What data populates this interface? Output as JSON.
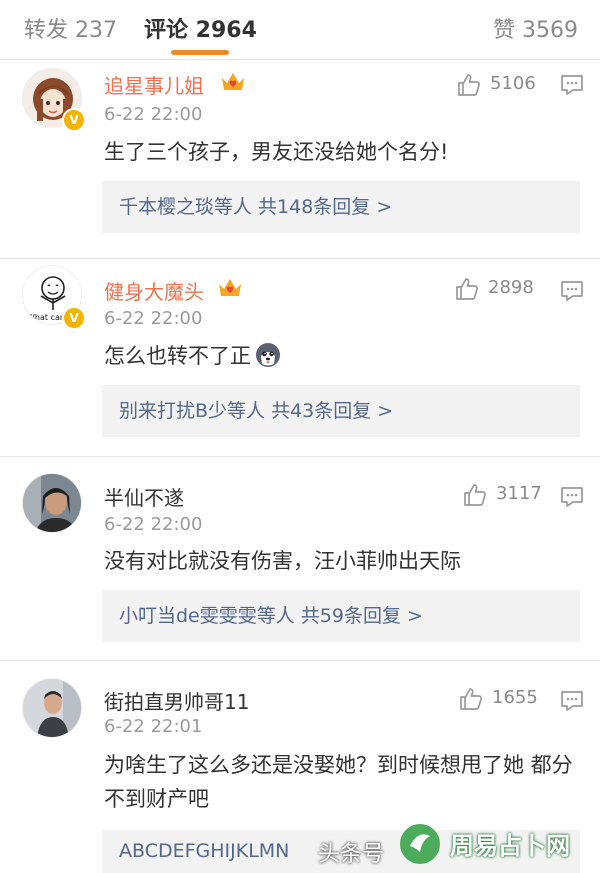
{
  "tabs": {
    "repost": "转发 237",
    "comments": "评论 2964",
    "likes": "赞 3569"
  },
  "colors": {
    "vip_name": "#eb7350",
    "tab_indicator": "#f08a24",
    "reply_link": "#55688a",
    "verified_badge": "#f5b400"
  },
  "icons": {
    "like": "thumbs-up-outline",
    "reply": "speech-bubble",
    "verified": "v-badge",
    "vip": "crown-heart"
  },
  "comments": [
    {
      "username": "追星事儿姐",
      "vip": true,
      "verified": true,
      "time": "6-22 22:00",
      "likes": "5106",
      "text": "生了三个孩子，男友还没给她个名分!",
      "replies": "千本樱之琰等人 共148条回复 >"
    },
    {
      "username": "健身大魔头",
      "vip": true,
      "verified": true,
      "avatar_text": "What can",
      "time": "6-22 22:00",
      "likes": "2898",
      "text": "怎么也转不了正",
      "replies": "别来打扰B少等人 共43条回复 >"
    },
    {
      "username": "半仙不遂",
      "vip": false,
      "verified": false,
      "time": "6-22 22:00",
      "likes": "3117",
      "text": "没有对比就没有伤害，汪小菲帅出天际",
      "replies": "小叮当de雯雯雯等人 共59条回复 >"
    },
    {
      "username": "街拍直男帅哥11",
      "vip": false,
      "verified": false,
      "time": "6-22 22:01",
      "likes": "1655",
      "text": "为啥生了这么多还是没娶她？到时候想甩了她 都分不到财产吧",
      "replies": "ABCDEFGHIJKLMN"
    }
  ],
  "watermark": {
    "source": "头条号",
    "site": "周易占卜网"
  }
}
